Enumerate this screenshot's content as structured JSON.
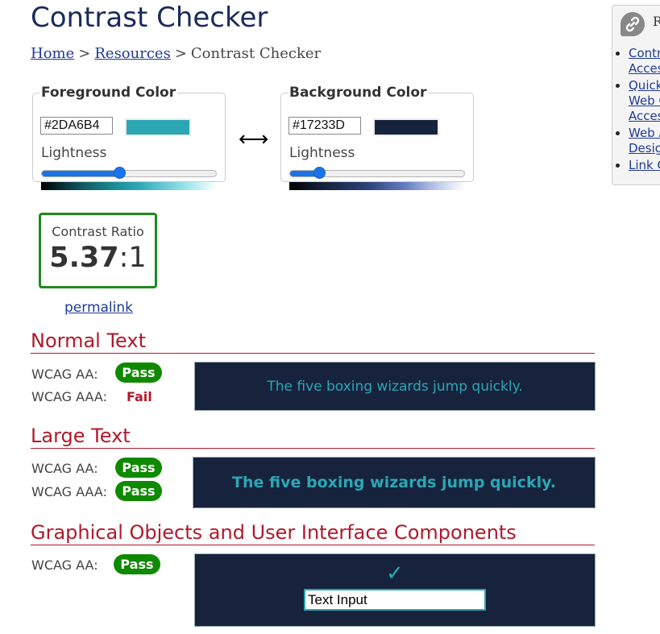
{
  "page": {
    "title": "Contrast Checker"
  },
  "breadcrumb": {
    "home": "Home",
    "resources": "Resources",
    "current": "Contrast Checker",
    "separator": ">"
  },
  "foreground": {
    "legend": "Foreground Color",
    "hex": "#2DA6B4",
    "lightness_label": "Lightness",
    "lightness_percent": 45,
    "swatch_color": "#2DA6B4"
  },
  "background": {
    "legend": "Background Color",
    "hex": "#17233D",
    "lightness_label": "Lightness",
    "lightness_percent": 17,
    "swatch_color": "#17233D"
  },
  "swap_icon": "left-right-arrow-icon",
  "contrast": {
    "label": "Contrast Ratio",
    "ratio_bold": "5.37",
    "ratio_rest": ":1",
    "permalink": "permalink"
  },
  "normal_text": {
    "heading": "Normal Text",
    "aa_label": "WCAG AA:",
    "aa_result": "Pass",
    "aaa_label": "WCAG AAA:",
    "aaa_result": "Fail",
    "sample": "The five boxing wizards jump quickly."
  },
  "large_text": {
    "heading": "Large Text",
    "aa_label": "WCAG AA:",
    "aa_result": "Pass",
    "aaa_label": "WCAG AAA:",
    "aaa_result": "Pass",
    "sample": "The five boxing wizards jump quickly."
  },
  "graphical": {
    "heading": "Graphical Objects and User Interface Components",
    "aa_label": "WCAG AA:",
    "aa_result": "Pass",
    "check_glyph": "✓",
    "input_value": "Text Input"
  },
  "sidebar": {
    "header": "R",
    "items": [
      {
        "label_lines": [
          "Contr",
          "Acces"
        ]
      },
      {
        "label_lines": [
          "Quick",
          "Web C",
          "Acces"
        ]
      },
      {
        "label_lines": [
          "Web A",
          "Desig"
        ]
      },
      {
        "label_lines": [
          "Link C"
        ]
      }
    ]
  },
  "colors": {
    "pass": "#0f8a00",
    "fail": "#b0192b",
    "accent_blue": "#1a73e8",
    "heading_red": "#b0192b"
  }
}
